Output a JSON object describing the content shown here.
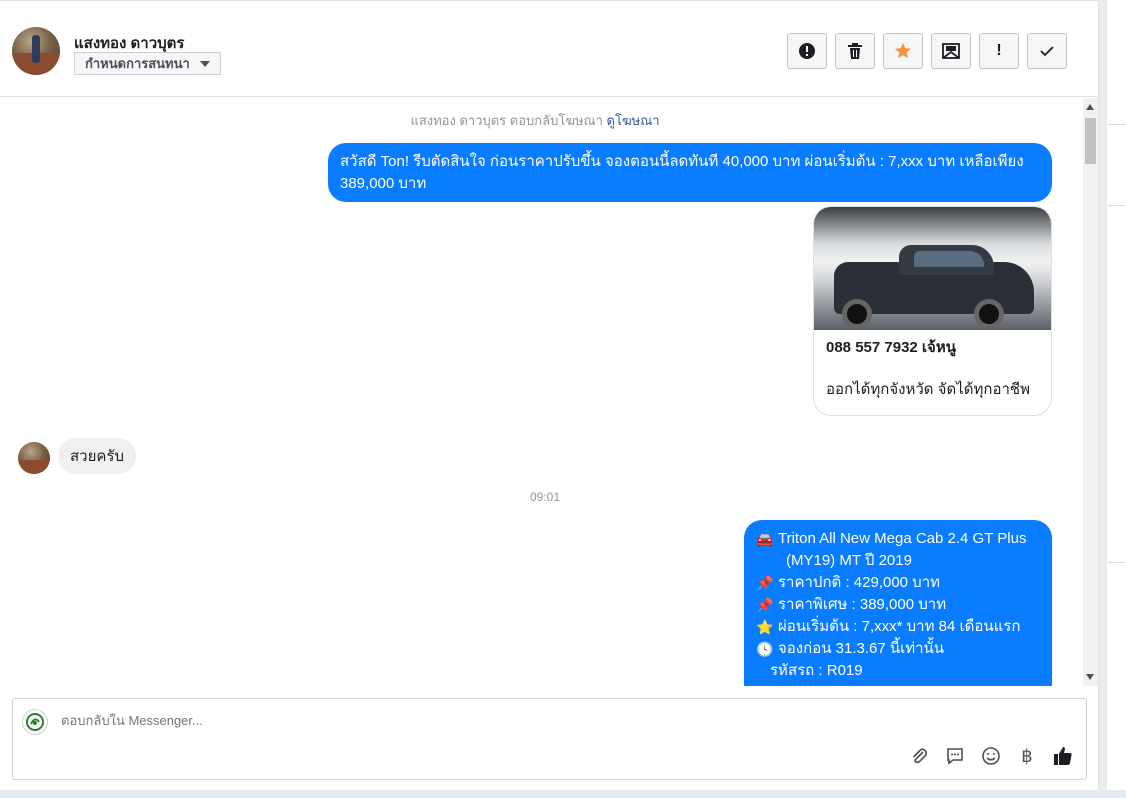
{
  "header": {
    "contact_name": "แสงทอง ดาวบุตร",
    "assign_label": "กำหนดการสนทนา",
    "actions": {
      "spam": "!",
      "mark_follow_up": "!"
    }
  },
  "thread": {
    "ad_reply_prefix": "แสงทอง ดาวบุตร ตอบกลับโฆษณา",
    "ad_reply_link": "ดูโฆษณา",
    "outgoing_1": "สวัสดี Ton! รีบตัดสินใจ ก่อนราคาปรับขึ้น จองตอนนี้ลดทันที 40,000 บาท ผ่อนเริ่มต้น : 7,xxx บาท เหลือเพียง 389,000 บาท",
    "card": {
      "title": "088 557 7932 เจ้หนู",
      "subtitle": "ออกได้ทุกจังหวัด จัดได้ทุกอาชีพ"
    },
    "incoming_1": "สวยครับ",
    "timestamp": "09:01",
    "outgoing_2": {
      "line1_icon": "🚘",
      "line1": "Triton All New Mega Cab 2.4 GT Plus",
      "line1_cont": "(MY19) MT ปี 2019",
      "line2_icon": "📌",
      "line2": "ราคาปกติ : 429,000 บาท",
      "line3_icon": "📌",
      "line3": "ราคาพิเศษ : 389,000 บาท",
      "line4_icon": "⭐",
      "line4": "ผ่อนเริ่มต้น : 7,xxx* บาท 84 เดือนแรก",
      "line5_icon": "🕓",
      "line5": "จองก่อน 31.3.67 นี้เท่านั้น",
      "line6": "รหัสรถ : R019"
    }
  },
  "composer": {
    "placeholder": "ตอบกลับใน Messenger...",
    "baht_symbol": "฿"
  },
  "colors": {
    "outgoing_bubble": "#0a7cff",
    "incoming_bubble": "#f1f0f0",
    "star": "#f7923a"
  }
}
